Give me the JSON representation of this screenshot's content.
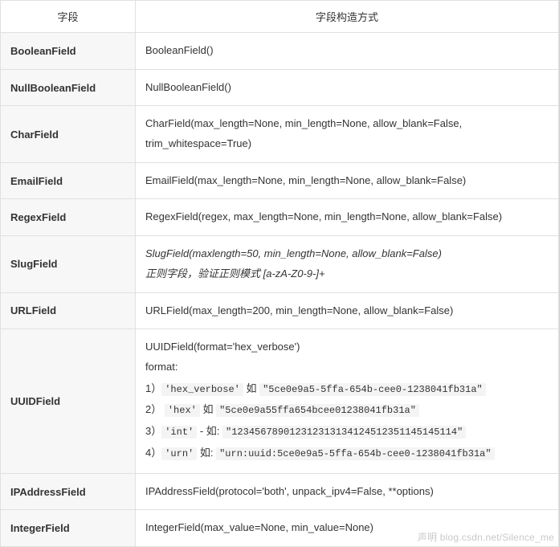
{
  "headers": {
    "field": "字段",
    "construct": "字段构造方式"
  },
  "rows": [
    {
      "name": "BooleanField",
      "type": "plain",
      "text": "BooleanField()"
    },
    {
      "name": "NullBooleanField",
      "type": "plain",
      "text": "NullBooleanField()"
    },
    {
      "name": "CharField",
      "type": "plain",
      "text": "CharField(max_length=None, min_length=None, allow_blank=False, trim_whitespace=True)"
    },
    {
      "name": "EmailField",
      "type": "plain",
      "text": "EmailField(max_length=None, min_length=None, allow_blank=False)"
    },
    {
      "name": "RegexField",
      "type": "plain",
      "text": "RegexField(regex, max_length=None, min_length=None, allow_blank=False)"
    },
    {
      "name": "SlugField",
      "type": "slug",
      "sig": "SlugField(maxlength=50, min_length=None, allow_blank=False)",
      "desc_pre": "正则字段，验证正则模式 [a-zA-Z0-9-]+"
    },
    {
      "name": "URLField",
      "type": "plain",
      "text": "URLField(max_length=200, min_length=None, allow_blank=False)"
    },
    {
      "name": "UUIDField",
      "type": "uuid",
      "sig": "UUIDField(format='hex_verbose')",
      "format_label": "format:",
      "items": [
        {
          "num": "1）",
          "key": "'hex_verbose'",
          "mid": " 如 ",
          "val": "\"5ce0e9a5-5ffa-654b-cee0-1238041fb31a\""
        },
        {
          "num": "2） ",
          "key": "'hex'",
          "mid": " 如  ",
          "val": "\"5ce0e9a55ffa654bcee01238041fb31a\""
        },
        {
          "num": "3）",
          "key": "'int'",
          "mid": " - 如: ",
          "val": "\"123456789012312313134124512351145145114\""
        },
        {
          "num": "4）",
          "key": "'urn'",
          "mid": " 如: ",
          "val": "\"urn:uuid:5ce0e9a5-5ffa-654b-cee0-1238041fb31a\""
        }
      ]
    },
    {
      "name": "IPAddressField",
      "type": "plain",
      "text": "IPAddressField(protocol='both', unpack_ipv4=False, **options)"
    },
    {
      "name": "IntegerField",
      "type": "plain",
      "text": "IntegerField(max_value=None, min_value=None)"
    }
  ],
  "watermark": "声明 blog.csdn.net/Silence_me"
}
